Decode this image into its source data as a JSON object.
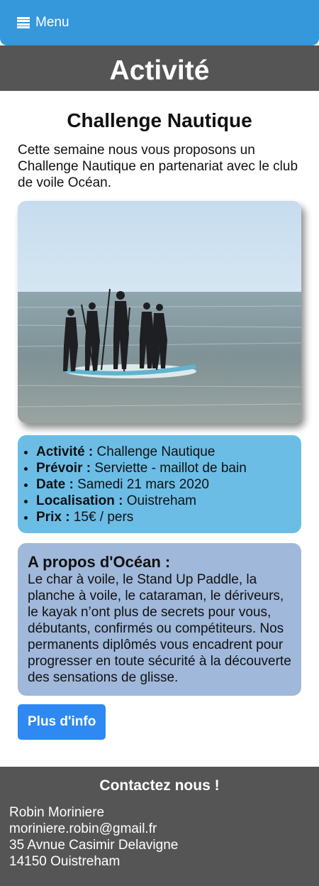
{
  "nav": {
    "menu_label": "Menu",
    "menu_icon": "hamburger-icon"
  },
  "header": {
    "title": "Activité"
  },
  "main": {
    "title": "Challenge Nautique",
    "intro": "Cette semaine nous vous proposons un Challenge Nautique en partenariat avec le club de voile Océan.",
    "photo_subject": "stand-up-paddle-photo",
    "details": [
      {
        "label": "Activité :",
        "value": "Challenge Nautique"
      },
      {
        "label": "Prévoir :",
        "value": "Serviette - maillot de bain"
      },
      {
        "label": "Date :",
        "value": "Samedi 21 mars 2020"
      },
      {
        "label": "Localisation :",
        "value": "Ouistreham"
      },
      {
        "label": "Prix :",
        "value": "15€ / pers"
      }
    ],
    "about": {
      "title": "A propos d'Océan :",
      "text": "Le char à voile, le Stand Up Paddle, la planche à voile, le cataraman, le dériveurs, le kayak n’ont plus de secrets pour vous, débutants, confirmés ou compétiteurs. Nos permanents diplômés vous encadrent pour progresser en toute sécurité à la découverte des sensations de glisse."
    },
    "more_button": "Plus d'info"
  },
  "footer": {
    "title": "Contactez nous !",
    "name": "Robin Moriniere",
    "email": "moriniere.robin@gmail.fr",
    "address": "35 Avnue Casimir Delavigne",
    "city": "14150 Ouistreham"
  },
  "colors": {
    "topbar": "#3498db",
    "header_bg": "#555555",
    "details_bg": "#6cbde6",
    "about_bg": "#a0b8da",
    "button": "#2e89f2"
  }
}
